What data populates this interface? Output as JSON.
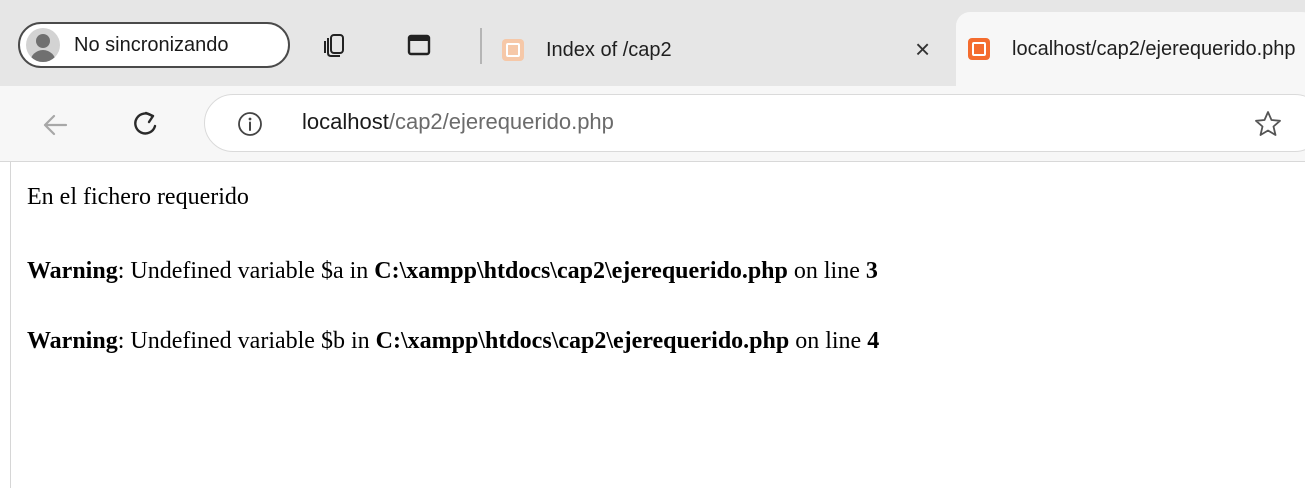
{
  "browser": {
    "profile_label": "No sincronizando",
    "tabs": [
      {
        "title": "Index of /cap2",
        "active": false,
        "close_glyph": "×"
      },
      {
        "title": "localhost/cap2/ejerequerido.php",
        "active": true
      }
    ],
    "address": {
      "host": "localhost",
      "path": "/cap2/ejerequerido.php"
    },
    "icons": {
      "profile": "avatar-icon",
      "workspaces": "workspaces-icon",
      "vertical_tabs": "vertical-tabs-icon",
      "favicon": "xampp-favicon",
      "back": "back-arrow-icon",
      "refresh": "refresh-icon",
      "info": "info-icon",
      "favorite": "star-icon"
    },
    "colors": {
      "tabstrip_bg": "#e6e6e6",
      "toolbar_bg": "#f7f7f7",
      "favicon_orange": "#f46c2e"
    }
  },
  "page": {
    "intro_text": "En el fichero requerido",
    "warnings": [
      {
        "label": "Warning",
        "message": ": Undefined variable $a in ",
        "file": "C:\\xampp\\htdocs\\cap2\\ejerequerido.php",
        "line_text": " on line ",
        "line_number": "3"
      },
      {
        "label": "Warning",
        "message": ": Undefined variable $b in ",
        "file": "C:\\xampp\\htdocs\\cap2\\ejerequerido.php",
        "line_text": " on line ",
        "line_number": "4"
      }
    ]
  }
}
